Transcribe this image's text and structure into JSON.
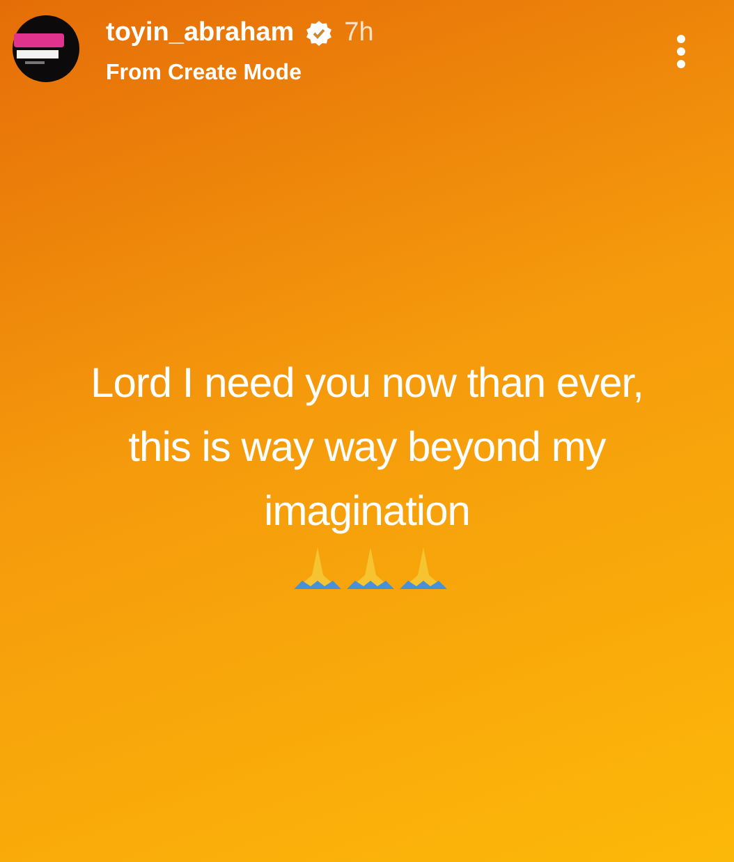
{
  "header": {
    "username": "toyin_abraham",
    "verified": true,
    "time": "7h",
    "subtitle": "From Create Mode"
  },
  "story": {
    "text": "Lord I need you now than ever, this is way way beyond my imagination"
  }
}
